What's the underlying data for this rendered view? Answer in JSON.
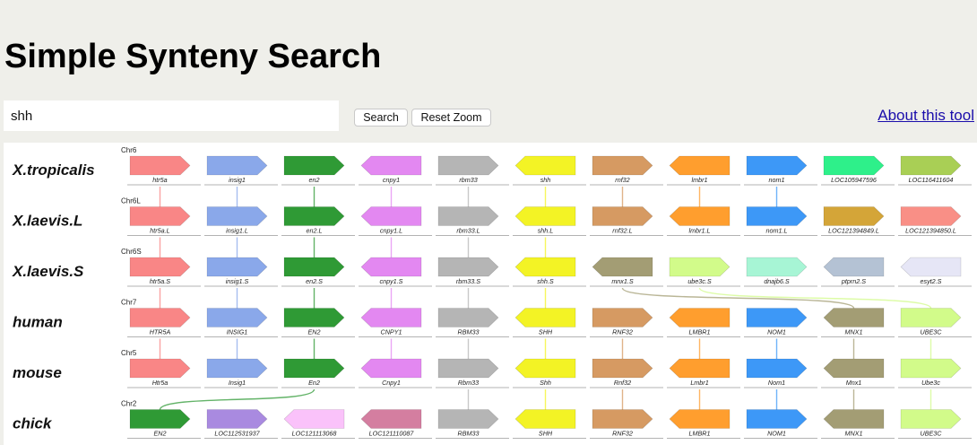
{
  "page": {
    "title": "Simple Synteny Search"
  },
  "search": {
    "value": "shh",
    "search_label": "Search",
    "reset_label": "Reset Zoom",
    "about_label": "About this tool"
  },
  "tracks": [
    {
      "species": "X.tropicalis",
      "chromosome": "Chr6",
      "genes": [
        {
          "label": "htr5a",
          "color": "#f98686",
          "dir": 1
        },
        {
          "label": "insig1",
          "color": "#8aa8ea",
          "dir": 1
        },
        {
          "label": "en2",
          "color": "#2f9a35",
          "dir": 1
        },
        {
          "label": "cnpy1",
          "color": "#e388f1",
          "dir": -1
        },
        {
          "label": "rbm33",
          "color": "#b5b5b5",
          "dir": 1
        },
        {
          "label": "shh",
          "color": "#f3f325",
          "dir": -1
        },
        {
          "label": "rnf32",
          "color": "#d69a62",
          "dir": 1
        },
        {
          "label": "lmbr1",
          "color": "#ff9e2e",
          "dir": -1
        },
        {
          "label": "nom1",
          "color": "#3d98f7",
          "dir": 1
        },
        {
          "label": "LOC105947596",
          "color": "#2ef08a",
          "dir": 1
        },
        {
          "label": "LOC116411604",
          "color": "#a9cf55",
          "dir": 1
        }
      ]
    },
    {
      "species": "X.laevis.L",
      "chromosome": "Chr6L",
      "genes": [
        {
          "label": "htr5a.L",
          "color": "#f98686",
          "dir": 1
        },
        {
          "label": "insig1.L",
          "color": "#8aa8ea",
          "dir": 1
        },
        {
          "label": "en2.L",
          "color": "#2f9a35",
          "dir": 1
        },
        {
          "label": "cnpy1.L",
          "color": "#e388f1",
          "dir": -1
        },
        {
          "label": "rbm33.L",
          "color": "#b5b5b5",
          "dir": 1
        },
        {
          "label": "shh.L",
          "color": "#f3f325",
          "dir": -1
        },
        {
          "label": "rnf32.L",
          "color": "#d69a62",
          "dir": 1
        },
        {
          "label": "lmbr1.L",
          "color": "#ff9e2e",
          "dir": -1
        },
        {
          "label": "nom1.L",
          "color": "#3d98f7",
          "dir": 1
        },
        {
          "label": "LOC121394849.L",
          "color": "#d4a538",
          "dir": 1
        },
        {
          "label": "LOC121394850.L",
          "color": "#f98f86",
          "dir": 1
        }
      ]
    },
    {
      "species": "X.laevis.S",
      "chromosome": "Chr6S",
      "genes": [
        {
          "label": "htr5a.S",
          "color": "#f98686",
          "dir": 1
        },
        {
          "label": "insig1.S",
          "color": "#8aa8ea",
          "dir": 1
        },
        {
          "label": "en2.S",
          "color": "#2f9a35",
          "dir": 1
        },
        {
          "label": "cnpy1.S",
          "color": "#e388f1",
          "dir": -1
        },
        {
          "label": "rbm33.S",
          "color": "#b5b5b5",
          "dir": 1
        },
        {
          "label": "shh.S",
          "color": "#f3f325",
          "dir": -1
        },
        {
          "label": "mnx1.S",
          "color": "#a39d74",
          "dir": -1
        },
        {
          "label": "ube3c.S",
          "color": "#d2fb8a",
          "dir": 1
        },
        {
          "label": "dnajb6.S",
          "color": "#a7f5d5",
          "dir": 1
        },
        {
          "label": "ptprn2.S",
          "color": "#b4c2d4",
          "dir": -1
        },
        {
          "label": "esyt2.S",
          "color": "#e6e6f6",
          "dir": -1
        }
      ]
    },
    {
      "species": "human",
      "chromosome": "Chr7",
      "genes": [
        {
          "label": "HTR5A",
          "color": "#f98686",
          "dir": 1
        },
        {
          "label": "INSIG1",
          "color": "#8aa8ea",
          "dir": 1
        },
        {
          "label": "EN2",
          "color": "#2f9a35",
          "dir": 1
        },
        {
          "label": "CNPY1",
          "color": "#e388f1",
          "dir": -1
        },
        {
          "label": "RBM33",
          "color": "#b5b5b5",
          "dir": 1
        },
        {
          "label": "SHH",
          "color": "#f3f325",
          "dir": -1
        },
        {
          "label": "RNF32",
          "color": "#d69a62",
          "dir": 1
        },
        {
          "label": "LMBR1",
          "color": "#ff9e2e",
          "dir": -1
        },
        {
          "label": "NOM1",
          "color": "#3d98f7",
          "dir": 1
        },
        {
          "label": "MNX1",
          "color": "#a39d74",
          "dir": -1
        },
        {
          "label": "UBE3C",
          "color": "#d2fb8a",
          "dir": 1
        }
      ]
    },
    {
      "species": "mouse",
      "chromosome": "Chr5",
      "genes": [
        {
          "label": "Htr5a",
          "color": "#f98686",
          "dir": 1
        },
        {
          "label": "Insig1",
          "color": "#8aa8ea",
          "dir": 1
        },
        {
          "label": "En2",
          "color": "#2f9a35",
          "dir": 1
        },
        {
          "label": "Cnpy1",
          "color": "#e388f1",
          "dir": -1
        },
        {
          "label": "Rbm33",
          "color": "#b5b5b5",
          "dir": 1
        },
        {
          "label": "Shh",
          "color": "#f3f325",
          "dir": -1
        },
        {
          "label": "Rnf32",
          "color": "#d69a62",
          "dir": 1
        },
        {
          "label": "Lmbr1",
          "color": "#ff9e2e",
          "dir": -1
        },
        {
          "label": "Nom1",
          "color": "#3d98f7",
          "dir": 1
        },
        {
          "label": "Mnx1",
          "color": "#a39d74",
          "dir": -1
        },
        {
          "label": "Ube3c",
          "color": "#d2fb8a",
          "dir": 1
        }
      ]
    },
    {
      "species": "chick",
      "chromosome": "Chr2",
      "genes": [
        {
          "label": "EN2",
          "color": "#2f9a35",
          "dir": 1
        },
        {
          "label": "LOC112531937",
          "color": "#a98ae0",
          "dir": 1
        },
        {
          "label": "LOC121113068",
          "color": "#fac2fa",
          "dir": -1
        },
        {
          "label": "LOC121110087",
          "color": "#d47ea0",
          "dir": -1
        },
        {
          "label": "RBM33",
          "color": "#b5b5b5",
          "dir": 1
        },
        {
          "label": "SHH",
          "color": "#f3f325",
          "dir": -1
        },
        {
          "label": "RNF32",
          "color": "#d69a62",
          "dir": 1
        },
        {
          "label": "LMBR1",
          "color": "#ff9e2e",
          "dir": -1
        },
        {
          "label": "NOM1",
          "color": "#3d98f7",
          "dir": 1
        },
        {
          "label": "MNX1",
          "color": "#a39d74",
          "dir": -1
        },
        {
          "label": "UBE3C",
          "color": "#d2fb8a",
          "dir": 1
        }
      ]
    }
  ],
  "links": [
    {
      "from": [
        0,
        0
      ],
      "to": [
        1,
        0
      ]
    },
    {
      "from": [
        0,
        1
      ],
      "to": [
        1,
        1
      ]
    },
    {
      "from": [
        0,
        2
      ],
      "to": [
        1,
        2
      ]
    },
    {
      "from": [
        0,
        3
      ],
      "to": [
        1,
        3
      ]
    },
    {
      "from": [
        0,
        4
      ],
      "to": [
        1,
        4
      ]
    },
    {
      "from": [
        0,
        5
      ],
      "to": [
        1,
        5
      ]
    },
    {
      "from": [
        0,
        6
      ],
      "to": [
        1,
        6
      ]
    },
    {
      "from": [
        0,
        7
      ],
      "to": [
        1,
        7
      ]
    },
    {
      "from": [
        0,
        8
      ],
      "to": [
        1,
        8
      ]
    },
    {
      "from": [
        1,
        0
      ],
      "to": [
        2,
        0
      ]
    },
    {
      "from": [
        1,
        1
      ],
      "to": [
        2,
        1
      ]
    },
    {
      "from": [
        1,
        2
      ],
      "to": [
        2,
        2
      ]
    },
    {
      "from": [
        1,
        3
      ],
      "to": [
        2,
        3
      ]
    },
    {
      "from": [
        1,
        4
      ],
      "to": [
        2,
        4
      ]
    },
    {
      "from": [
        1,
        5
      ],
      "to": [
        2,
        5
      ]
    },
    {
      "from": [
        2,
        0
      ],
      "to": [
        3,
        0
      ]
    },
    {
      "from": [
        2,
        1
      ],
      "to": [
        3,
        1
      ]
    },
    {
      "from": [
        2,
        2
      ],
      "to": [
        3,
        2
      ]
    },
    {
      "from": [
        2,
        3
      ],
      "to": [
        3,
        3
      ]
    },
    {
      "from": [
        2,
        4
      ],
      "to": [
        3,
        4
      ]
    },
    {
      "from": [
        2,
        5
      ],
      "to": [
        3,
        5
      ]
    },
    {
      "from": [
        2,
        6
      ],
      "to": [
        3,
        9
      ]
    },
    {
      "from": [
        2,
        7
      ],
      "to": [
        3,
        10
      ]
    },
    {
      "from": [
        3,
        0
      ],
      "to": [
        4,
        0
      ]
    },
    {
      "from": [
        3,
        1
      ],
      "to": [
        4,
        1
      ]
    },
    {
      "from": [
        3,
        2
      ],
      "to": [
        4,
        2
      ]
    },
    {
      "from": [
        3,
        3
      ],
      "to": [
        4,
        3
      ]
    },
    {
      "from": [
        3,
        4
      ],
      "to": [
        4,
        4
      ]
    },
    {
      "from": [
        3,
        5
      ],
      "to": [
        4,
        5
      ]
    },
    {
      "from": [
        3,
        6
      ],
      "to": [
        4,
        6
      ]
    },
    {
      "from": [
        3,
        7
      ],
      "to": [
        4,
        7
      ]
    },
    {
      "from": [
        3,
        8
      ],
      "to": [
        4,
        8
      ]
    },
    {
      "from": [
        3,
        9
      ],
      "to": [
        4,
        9
      ]
    },
    {
      "from": [
        3,
        10
      ],
      "to": [
        4,
        10
      ]
    },
    {
      "from": [
        4,
        2
      ],
      "to": [
        5,
        0
      ]
    },
    {
      "from": [
        4,
        4
      ],
      "to": [
        5,
        4
      ]
    },
    {
      "from": [
        4,
        5
      ],
      "to": [
        5,
        5
      ]
    },
    {
      "from": [
        4,
        6
      ],
      "to": [
        5,
        6
      ]
    },
    {
      "from": [
        4,
        7
      ],
      "to": [
        5,
        7
      ]
    },
    {
      "from": [
        4,
        8
      ],
      "to": [
        5,
        8
      ]
    },
    {
      "from": [
        4,
        9
      ],
      "to": [
        5,
        9
      ]
    },
    {
      "from": [
        4,
        10
      ],
      "to": [
        5,
        10
      ]
    }
  ]
}
